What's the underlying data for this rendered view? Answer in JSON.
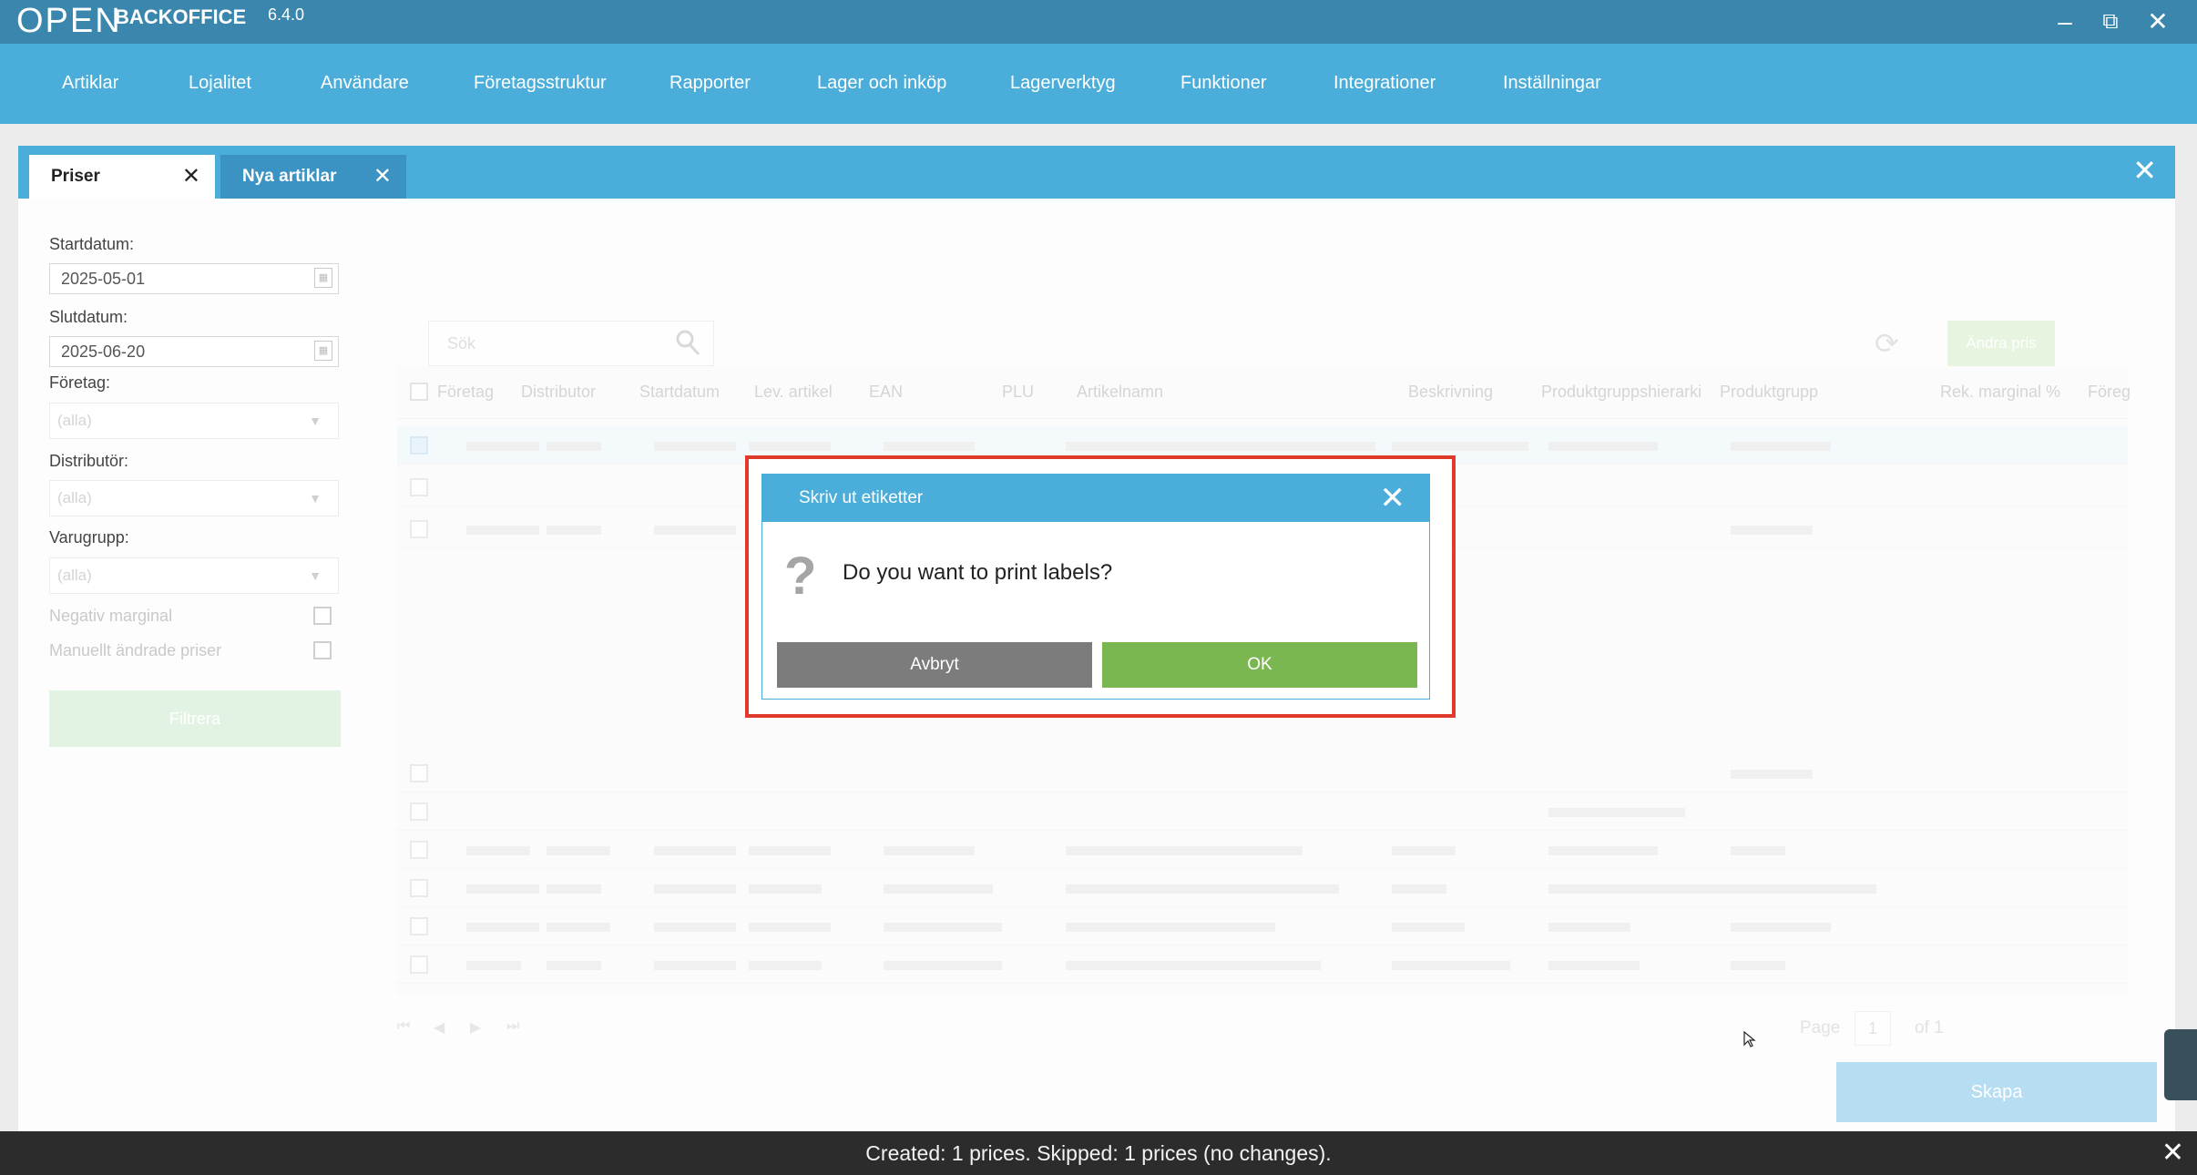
{
  "app": {
    "logo_text": "OPEN",
    "brand": "BACKOFFICE",
    "version": "6.4.0"
  },
  "window_controls": {
    "minimize": "–",
    "restore": "⧉",
    "close": "✕"
  },
  "nav": {
    "items": [
      "Artiklar",
      "Lojalitet",
      "Användare",
      "Företagsstruktur",
      "Rapporter",
      "Lager och inköp",
      "Lagerverktyg",
      "Funktioner",
      "Integrationer",
      "Inställningar"
    ]
  },
  "tabs": [
    {
      "label": "Priser",
      "active": true
    },
    {
      "label": "Nya artiklar",
      "active": false
    }
  ],
  "filters": {
    "start_label": "Startdatum:",
    "start_value": "2025-05-01",
    "end_label": "Slutdatum:",
    "end_value": "2025-06-20",
    "company_label": "Företag:",
    "company_value": "(alla)",
    "distributor_label": "Distributör:",
    "distributor_value": "(alla)",
    "group_label": "Varugrupp:",
    "group_value": "(alla)",
    "neg_margin_label": "Negativ marginal",
    "manual_label": "Manuellt ändrade priser",
    "filter_button": "Filtrera"
  },
  "toolbar": {
    "search_placeholder": "Sök",
    "change_button": "Ändra pris"
  },
  "grid": {
    "columns": [
      "Företag",
      "Distributor",
      "Startdatum",
      "Lev. artikel",
      "EAN",
      "PLU",
      "Artikelnamn",
      "Beskrivning",
      "Produktgruppshierarki",
      "Produktgrupp",
      "Rek. marginal %",
      "Föreg"
    ]
  },
  "pager": {
    "page_label": "Page",
    "page_value": "1",
    "of_label": "of 1"
  },
  "actions": {
    "create_button": "Skapa"
  },
  "dialog": {
    "title": "Skriv ut etiketter",
    "message": "Do you want to print labels?",
    "cancel_label": "Avbryt",
    "ok_label": "OK"
  },
  "notification": {
    "text": "Created: 1 prices. Skipped: 1 prices (no changes)."
  },
  "colors": {
    "nav_blue": "#4badd9",
    "titlebar_blue": "#3a86ad",
    "ok_green": "#7ab751",
    "cancel_gray": "#7c7c7c",
    "highlight_red": "#e03a2a"
  }
}
